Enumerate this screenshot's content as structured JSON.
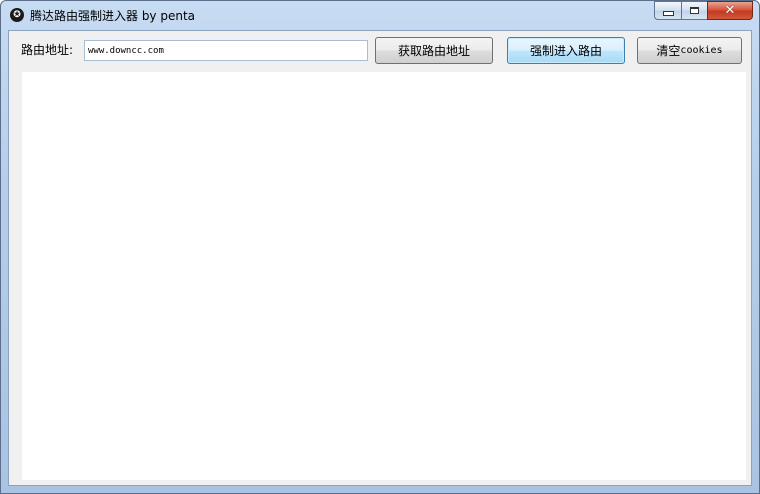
{
  "window": {
    "title": "腾达路由强制进入器 by penta",
    "icon": "app-star-icon",
    "caption_icons": [
      "minimize-icon",
      "maximize-icon",
      "close-icon"
    ],
    "close_glyph": "✕",
    "icon_glyph": "✪"
  },
  "form": {
    "address_label": "路由地址:",
    "address_value": "www.downcc.com",
    "fetch_button": "获取路由地址",
    "force_button": "强制进入路由",
    "clear_button_prefix": "清空",
    "clear_button_suffix": "cookies"
  },
  "output": {
    "content": ""
  },
  "colors": {
    "titlebar": "#b5cde9",
    "client_bg": "#f0f0f0",
    "close_button": "#c23a22",
    "focused_button_border": "#3c7fb1"
  }
}
